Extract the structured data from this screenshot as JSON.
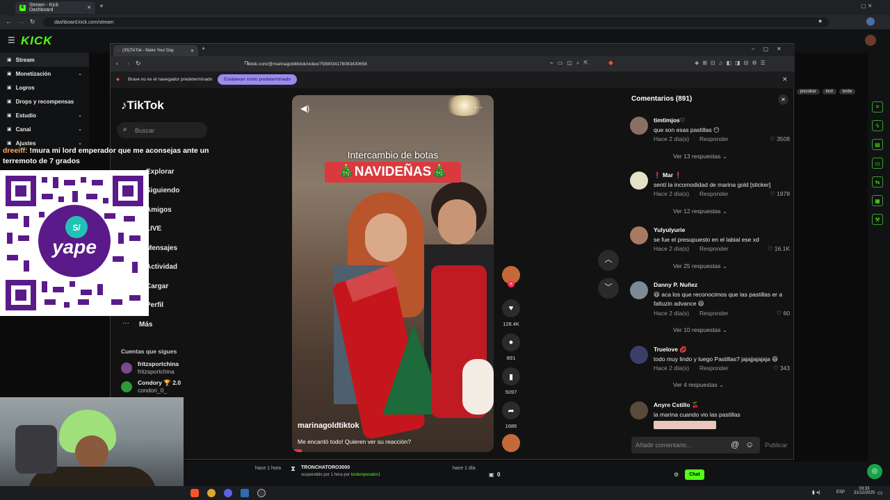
{
  "outer_browser": {
    "tab_title": "Stream - Kick Dashboard",
    "url": "dashboard.kick.com/stream"
  },
  "kick": {
    "logo": "KICK",
    "sidebar": [
      {
        "label": "Stream",
        "active": true,
        "chevron": false
      },
      {
        "label": "Monetización",
        "active": false,
        "chevron": true
      },
      {
        "label": "Logros",
        "active": false,
        "chevron": false
      },
      {
        "label": "Drops y recompensas",
        "active": false,
        "chevron": false
      },
      {
        "label": "Estudio",
        "active": false,
        "chevron": true
      },
      {
        "label": "Canal",
        "active": false,
        "chevron": true
      },
      {
        "label": "Ajustes",
        "active": false,
        "chevron": true
      }
    ],
    "bottom": {
      "left_time": "hace 1 hora",
      "middle_user": "TRONCHATORO3000",
      "middle_text": "suspendido por 1 hora por",
      "middle_by": "lordemperador1",
      "middle_time": "hace 1 día",
      "count": "0",
      "chat_button": "Chat"
    },
    "tags": [
      "jescobar",
      "lord",
      "lorde"
    ]
  },
  "inner_browser": {
    "tab_title": "(35)TikTok - Make Your Day",
    "url": "tiktok.com/@marinagoldtiktok/video/7589034176083430658",
    "banner_text": "Brave no es el navegador predeterminado",
    "banner_button": "Establecer como predeterminado"
  },
  "tiktok": {
    "logo": "TikTok",
    "search_placeholder": "Buscar",
    "nav": [
      "Explorar",
      "Siguiendo",
      "Amigos",
      "LIVE",
      "Mensajes",
      "Actividad",
      "Cargar",
      "Perfil",
      "Más"
    ],
    "following_title": "Cuentas que sigues",
    "following": [
      {
        "name": "fritzsportchina",
        "handle": "fritzsportchina"
      },
      {
        "name": "Condory 🏆 2.0",
        "handle": "condori_0_"
      }
    ],
    "video": {
      "title_line1": "Intercambio de botas",
      "title_line2": "🎄NAVIDEÑAS🎄",
      "username": "marinagoldtiktok",
      "caption": "Me encantó todo! Quieren ver su reacción?"
    },
    "actions": {
      "likes": "128.4K",
      "comments": "891",
      "saves": "5097",
      "shares": "1686"
    },
    "comments_header": "Comentarios (891)",
    "comments": [
      {
        "user": "timtimjos♡",
        "text": "que son esas pastillas 😶",
        "age": "Hace 2 día(s)",
        "reply": "Responder",
        "likes": "3508",
        "more": "Ver 13 respuestas"
      },
      {
        "user": "❗ Mar ❗",
        "text": "sentí la incomodidad de marina gold [sticker]",
        "age": "Hace 2 día(s)",
        "reply": "Responder",
        "likes": "1978",
        "more": "Ver 12 respuestas"
      },
      {
        "user": "Yulyulyurie",
        "text": "se fue el presupuesto en el labial ese xd",
        "age": "Hace 2 día(s)",
        "reply": "Responder",
        "likes": "16.1K",
        "more": "Ver 25 respuestas"
      },
      {
        "user": "Danny P. Nuñez",
        "text": "😆 aca los que reconocimos que las pastillas er a faltuzin advance 😆",
        "age": "Hace 2 día(s)",
        "reply": "Responder",
        "likes": "60",
        "more": "Ver 10 respuestas"
      },
      {
        "user": "Truelove 💋",
        "text": "todo muy lindo y luego Pastillas? jajajjajajaja 😆",
        "age": "Hace 2 día(s)",
        "reply": "Responder",
        "likes": "343",
        "more": "Ver 4 respuestas"
      },
      {
        "user": "Anyre Cstillo 🍒",
        "text": "la marina cuando vio las pastillas",
        "age": "",
        "reply": "",
        "likes": "",
        "more": ""
      }
    ],
    "comment_placeholder": "Añadir comentario...",
    "post_label": "Publicar"
  },
  "overlay": {
    "chat_user": "dreeiff:",
    "chat_text": "!mura mi lord emperador que me aconsejas ante un terremoto de 7 grados",
    "qr_brand": "yape"
  },
  "taskbar": {
    "lang": "ESP",
    "time": "03:33",
    "date": "31/12/2025"
  }
}
